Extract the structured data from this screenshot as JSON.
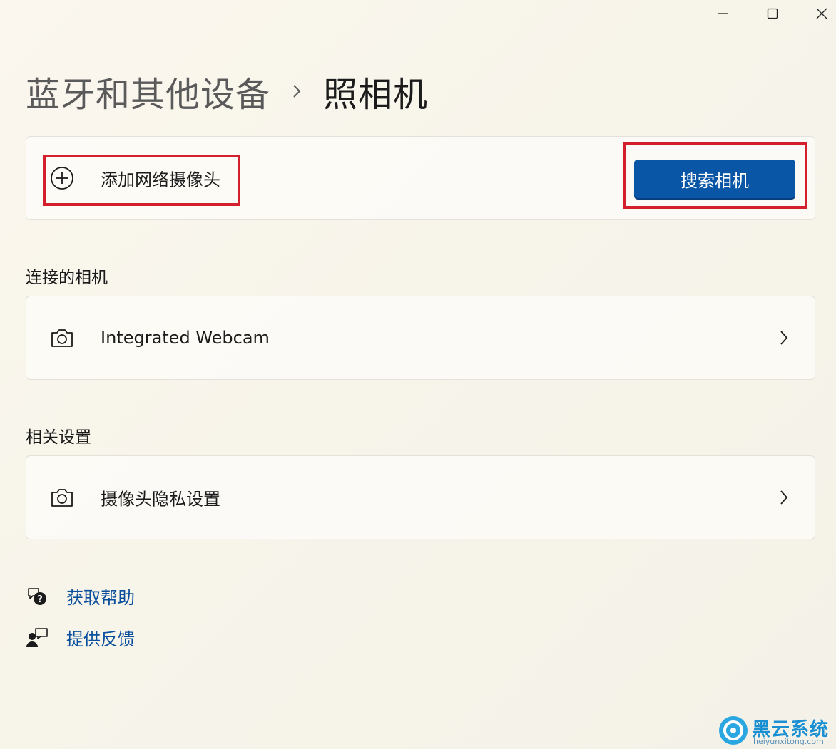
{
  "window": {
    "minimize_icon": "minimize-icon",
    "maximize_icon": "maximize-icon",
    "close_icon": "close-icon"
  },
  "breadcrumb": {
    "parent": "蓝牙和其他设备",
    "separator_icon": "chevron-right-icon",
    "current": "照相机"
  },
  "add_camera": {
    "icon": "add-circle-icon",
    "label": "添加网络摄像头",
    "button_label": "搜索相机"
  },
  "connected": {
    "title": "连接的相机",
    "items": [
      {
        "icon": "camera-icon",
        "label": "Integrated Webcam"
      }
    ]
  },
  "related": {
    "title": "相关设置",
    "items": [
      {
        "icon": "camera-icon",
        "label": "摄像头隐私设置"
      }
    ]
  },
  "links": {
    "help": {
      "icon": "help-chat-icon",
      "label": "获取帮助"
    },
    "feedback": {
      "icon": "feedback-icon",
      "label": "提供反馈"
    }
  },
  "watermark": {
    "title": "黑云系统",
    "url": "heiyunxitong.com"
  },
  "colors": {
    "accent": "#0a56a6",
    "link": "#0a4f9c",
    "highlight_border": "#d4202c"
  }
}
